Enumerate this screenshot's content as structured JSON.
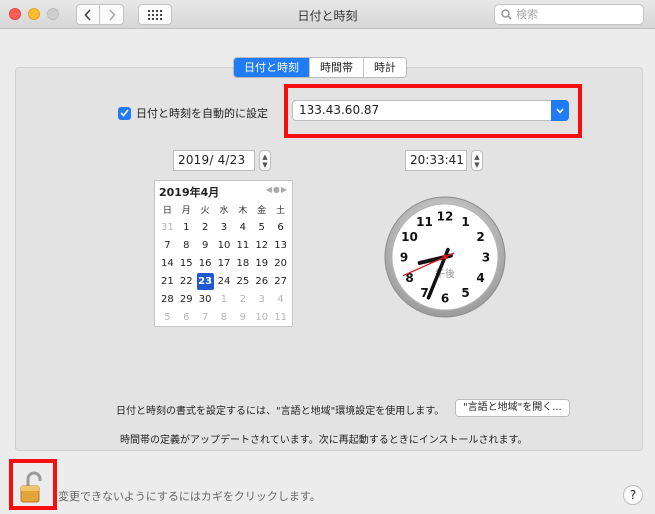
{
  "window": {
    "title": "日付と時刻"
  },
  "search": {
    "placeholder": "検索"
  },
  "tabs": [
    {
      "label": "日付と時刻",
      "active": true
    },
    {
      "label": "時間帯",
      "active": false
    },
    {
      "label": "時計",
      "active": false
    }
  ],
  "auto": {
    "label": "日付と時刻を自動的に設定",
    "checked": true,
    "server": "133.43.60.87"
  },
  "date": {
    "value": "2019/  4/23"
  },
  "time": {
    "value": "20:33:41"
  },
  "calendar": {
    "title": "2019年4月",
    "weekdays": [
      "日",
      "月",
      "火",
      "水",
      "木",
      "金",
      "土"
    ],
    "weeks": [
      [
        "31",
        "1",
        "2",
        "3",
        "4",
        "5",
        "6"
      ],
      [
        "7",
        "8",
        "9",
        "10",
        "11",
        "12",
        "13"
      ],
      [
        "14",
        "15",
        "16",
        "17",
        "18",
        "19",
        "20"
      ],
      [
        "21",
        "22",
        "23",
        "24",
        "25",
        "26",
        "27"
      ],
      [
        "28",
        "29",
        "30",
        "1",
        "2",
        "3",
        "4"
      ],
      [
        "5",
        "6",
        "7",
        "8",
        "9",
        "10",
        "11"
      ]
    ],
    "selected": "23"
  },
  "clock": {
    "ampm": "午後",
    "numbers": [
      "12",
      "1",
      "2",
      "3",
      "4",
      "5",
      "6",
      "7",
      "8",
      "9",
      "10",
      "11"
    ],
    "hour": 8,
    "minute": 33,
    "second": 41
  },
  "format": {
    "text": "日付と時刻の書式を設定するには、\"言語と地域\"環境設定を使用します。",
    "button": "\"言語と地域\"を開く..."
  },
  "timezone_notice": "時間帯の定義がアップデートされています。次に再起動するときにインストールされます。",
  "lock": {
    "text": "変更できないようにするにはカギをクリックします。"
  },
  "help": {
    "label": "?"
  },
  "colors": {
    "accent": "#1f7cf6",
    "highlight": "#f60d0d",
    "second_hand": "#e0151a"
  }
}
